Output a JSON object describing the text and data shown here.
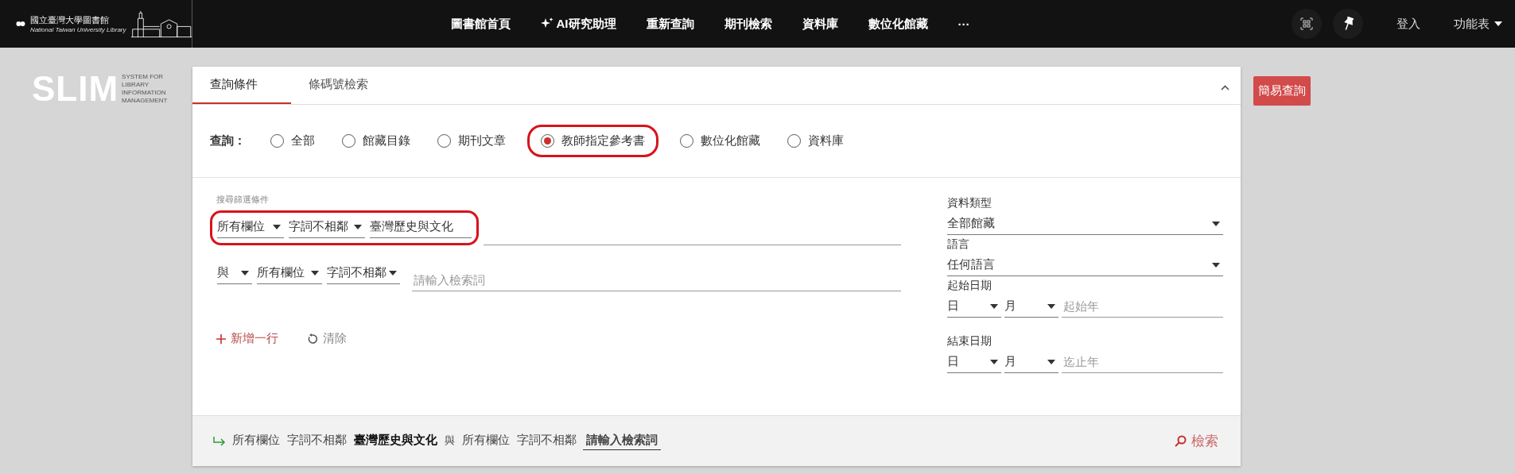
{
  "header": {
    "logo": {
      "name": "國立臺灣大學圖書館",
      "english": "National Taiwan University Library"
    },
    "nav": [
      {
        "label": "圖書館首頁",
        "kind": "text"
      },
      {
        "label": "AI研究助理",
        "kind": "sparkle"
      },
      {
        "label": "重新查詢",
        "kind": "text"
      },
      {
        "label": "期刊檢索",
        "kind": "text"
      },
      {
        "label": "資料庫",
        "kind": "text"
      },
      {
        "label": "數位化館藏",
        "kind": "text"
      },
      {
        "label": "···",
        "kind": "text"
      }
    ],
    "login": "登入",
    "menu": "功能表"
  },
  "brand": {
    "title": "SLIM",
    "subtitle": [
      "SYSTEM FOR",
      "LIBRARY",
      "INFORMATION",
      "MANAGEMENT"
    ]
  },
  "tabs": [
    {
      "label": "查詢條件",
      "selected": true
    },
    {
      "label": "條碼號檢索",
      "selected": false
    }
  ],
  "scope": {
    "label": "查詢：",
    "options": [
      {
        "label": "全部",
        "selected": false,
        "highlighted": false
      },
      {
        "label": "館藏目錄",
        "selected": false,
        "highlighted": false
      },
      {
        "label": "期刊文章",
        "selected": false,
        "highlighted": false
      },
      {
        "label": "教師指定參考書",
        "selected": true,
        "highlighted": true
      },
      {
        "label": "數位化館藏",
        "selected": false,
        "highlighted": false
      },
      {
        "label": "資料庫",
        "selected": false,
        "highlighted": false
      }
    ]
  },
  "filter_label": "搜尋篩選條件",
  "query_rows": [
    {
      "field": "所有欄位",
      "match": "字詞不相鄰",
      "value": "臺灣歷史與文化",
      "highlighted": true
    },
    {
      "operator": "與",
      "field": "所有欄位",
      "match": "字詞不相鄰",
      "placeholder": "請輸入檢索詞"
    }
  ],
  "add_row": "新增一行",
  "clear": "清除",
  "side": {
    "type_label": "資料類型",
    "type_value": "全部館藏",
    "lang_label": "語言",
    "lang_value": "任何語言",
    "start_label": "起始日期",
    "start": {
      "day": "日",
      "month": "月",
      "year_placeholder": "起始年"
    },
    "end_label": "結束日期",
    "end": {
      "day": "日",
      "month": "月",
      "year_placeholder": "迄止年"
    }
  },
  "summary": [
    {
      "text": "所有欄位",
      "kind": "plain"
    },
    {
      "text": "字詞不相鄰",
      "kind": "plain"
    },
    {
      "text": "臺灣歷史與文化",
      "kind": "term"
    },
    {
      "text": "與",
      "kind": "operator"
    },
    {
      "text": "所有欄位",
      "kind": "plain"
    },
    {
      "text": "字詞不相鄰",
      "kind": "plain"
    },
    {
      "text": "請輸入檢索詞",
      "kind": "empty"
    }
  ],
  "search_button": "檢索",
  "simple_button": "簡易查詢"
}
